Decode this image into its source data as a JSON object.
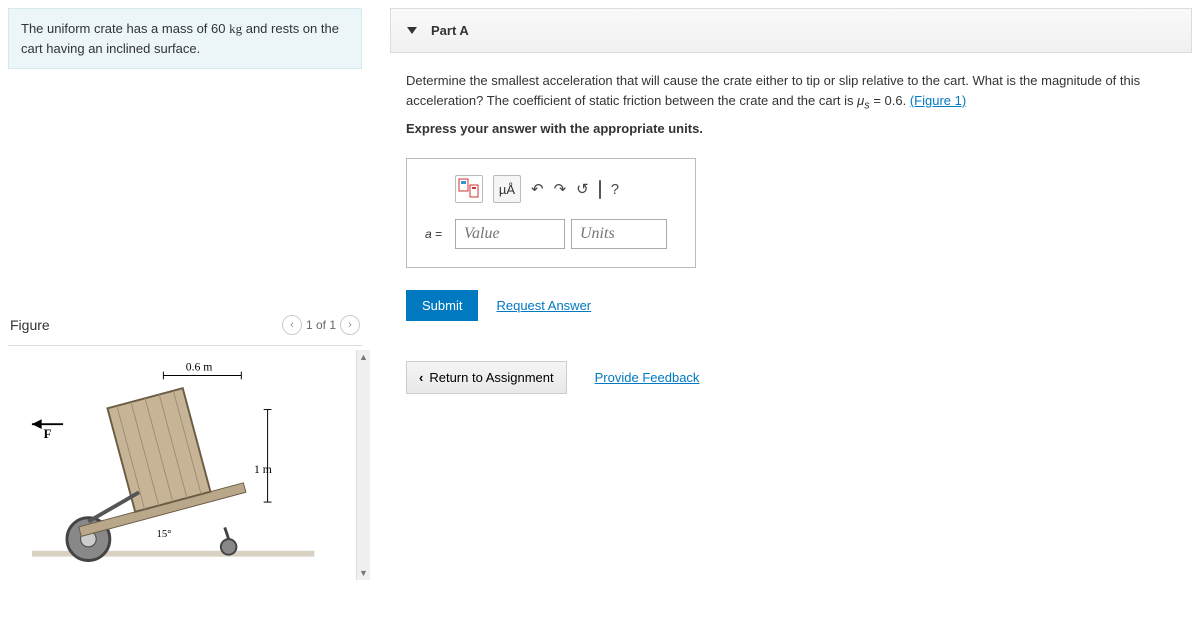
{
  "problem": {
    "statement_pre": "The uniform crate has a mass of 60 ",
    "statement_unit": "kg",
    "statement_post": " and rests on the cart having an inclined surface."
  },
  "figure": {
    "title": "Figure",
    "nav_text": "1 of 1",
    "dim_width": "0.6 m",
    "dim_height": "1 m",
    "angle": "15°",
    "force_label": "F"
  },
  "partA": {
    "header": "Part A",
    "question_pre": "Determine the smallest acceleration that will cause the crate either to tip or slip relative to the cart. What is the magnitude of this acceleration? The coefficient of static friction between the crate and the cart is ",
    "mu_symbol": "μ",
    "mu_sub": "s",
    "mu_eq": " = 0.6.",
    "fig_link": "(Figure 1)",
    "express": "Express your answer with the appropriate units.",
    "mu_tool": "µÅ",
    "help_label": "?",
    "eq_label": "a =",
    "value_placeholder": "Value",
    "units_placeholder": "Units",
    "submit": "Submit",
    "request": "Request Answer"
  },
  "footer": {
    "return": "Return to Assignment",
    "feedback": "Provide Feedback"
  }
}
